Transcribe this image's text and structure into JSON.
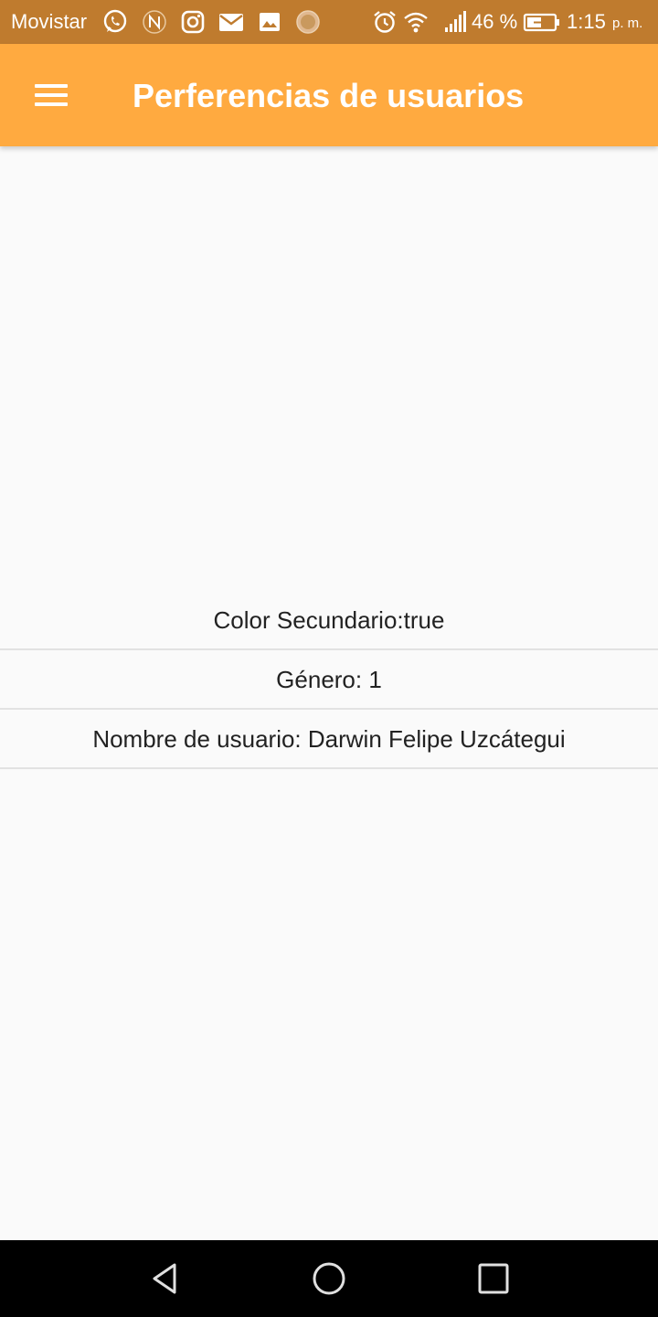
{
  "status_bar": {
    "carrier": "Movistar",
    "battery_percent": "46 %",
    "time": "1:15",
    "am_pm": "p. m.",
    "color": "#BF7B2E",
    "icons": [
      "whatsapp-icon",
      "nfc-icon",
      "instagram-icon",
      "mail-icon",
      "image-icon",
      "circle-app-icon",
      "alarm-icon",
      "wifi-icon",
      "signal-icon",
      "battery-charging-icon"
    ]
  },
  "app_bar": {
    "title": "Perferencias de usuarios",
    "menu_icon": "hamburger-menu-icon",
    "color": "#FFAA40"
  },
  "preferences": [
    {
      "text": "Color Secundario:true"
    },
    {
      "text": "Género: 1"
    },
    {
      "text": "Nombre de usuario: Darwin Felipe Uzcátegui"
    }
  ],
  "nav_bar": {
    "icons": [
      "back-icon",
      "home-icon",
      "recents-icon"
    ]
  }
}
